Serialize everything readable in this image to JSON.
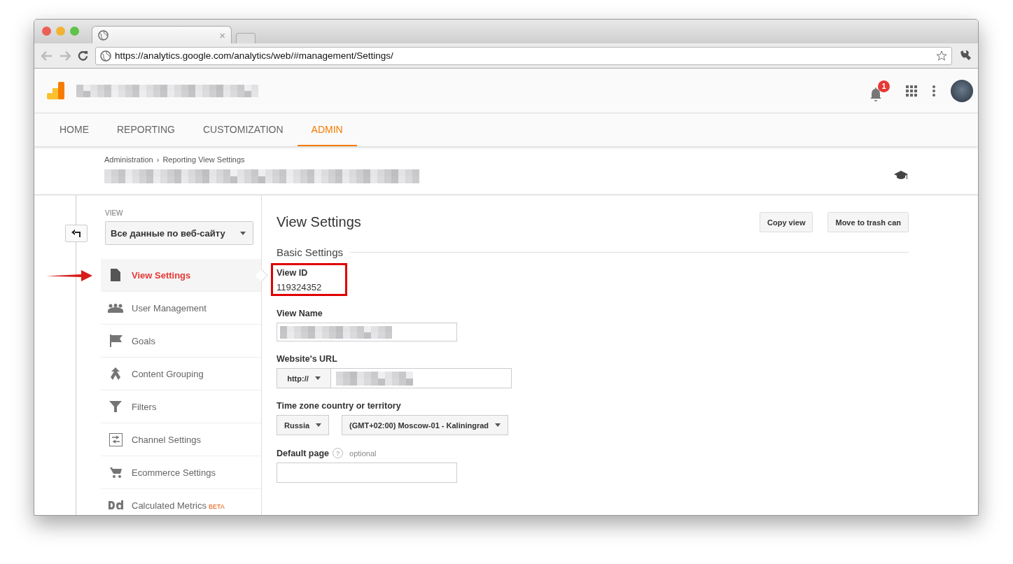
{
  "browser": {
    "tab_close": "×",
    "url": "https://analytics.google.com/analytics/web/#management/Settings/"
  },
  "header": {
    "notification_count": "1"
  },
  "nav": [
    {
      "label": "HOME",
      "selected": false
    },
    {
      "label": "REPORTING",
      "selected": false
    },
    {
      "label": "CUSTOMIZATION",
      "selected": false
    },
    {
      "label": "ADMIN",
      "selected": true
    }
  ],
  "breadcrumb": {
    "items": [
      "Administration",
      "Reporting View Settings"
    ],
    "separator": "›"
  },
  "sidebar": {
    "section_label": "VIEW",
    "view_select": "Все данные по веб-сайту",
    "items": [
      {
        "label": "View Settings",
        "kind": "document",
        "selected": true,
        "pointed": true
      },
      {
        "label": "User Management",
        "kind": "users",
        "selected": false,
        "pointed": false
      },
      {
        "label": "Goals",
        "kind": "flag",
        "selected": false,
        "pointed": false
      },
      {
        "label": "Content Grouping",
        "kind": "merge",
        "selected": false,
        "pointed": false
      },
      {
        "label": "Filters",
        "kind": "filter",
        "selected": false,
        "pointed": false
      },
      {
        "label": "Channel Settings",
        "kind": "channel",
        "selected": false,
        "pointed": false
      },
      {
        "label": "Ecommerce Settings",
        "kind": "cart",
        "selected": false,
        "pointed": false
      },
      {
        "label": "Calculated Metrics",
        "badge": "BETA",
        "kind": "metrics",
        "selected": false,
        "pointed": false
      }
    ]
  },
  "main": {
    "title": "View Settings",
    "buttons": [
      "Copy view",
      "Move to trash can"
    ],
    "section": "Basic Settings",
    "view_id": {
      "label": "View ID",
      "value": "119324352",
      "highlighted": true
    },
    "view_name": {
      "label": "View Name"
    },
    "website_url": {
      "label": "Website's URL",
      "protocol": "http://"
    },
    "time_zone": {
      "label": "Time zone country or territory",
      "country": "Russia",
      "zone": "(GMT+02:00) Moscow-01 - Kaliningrad"
    },
    "default_page": {
      "label": "Default page",
      "help": "?",
      "hint": "optional"
    }
  }
}
